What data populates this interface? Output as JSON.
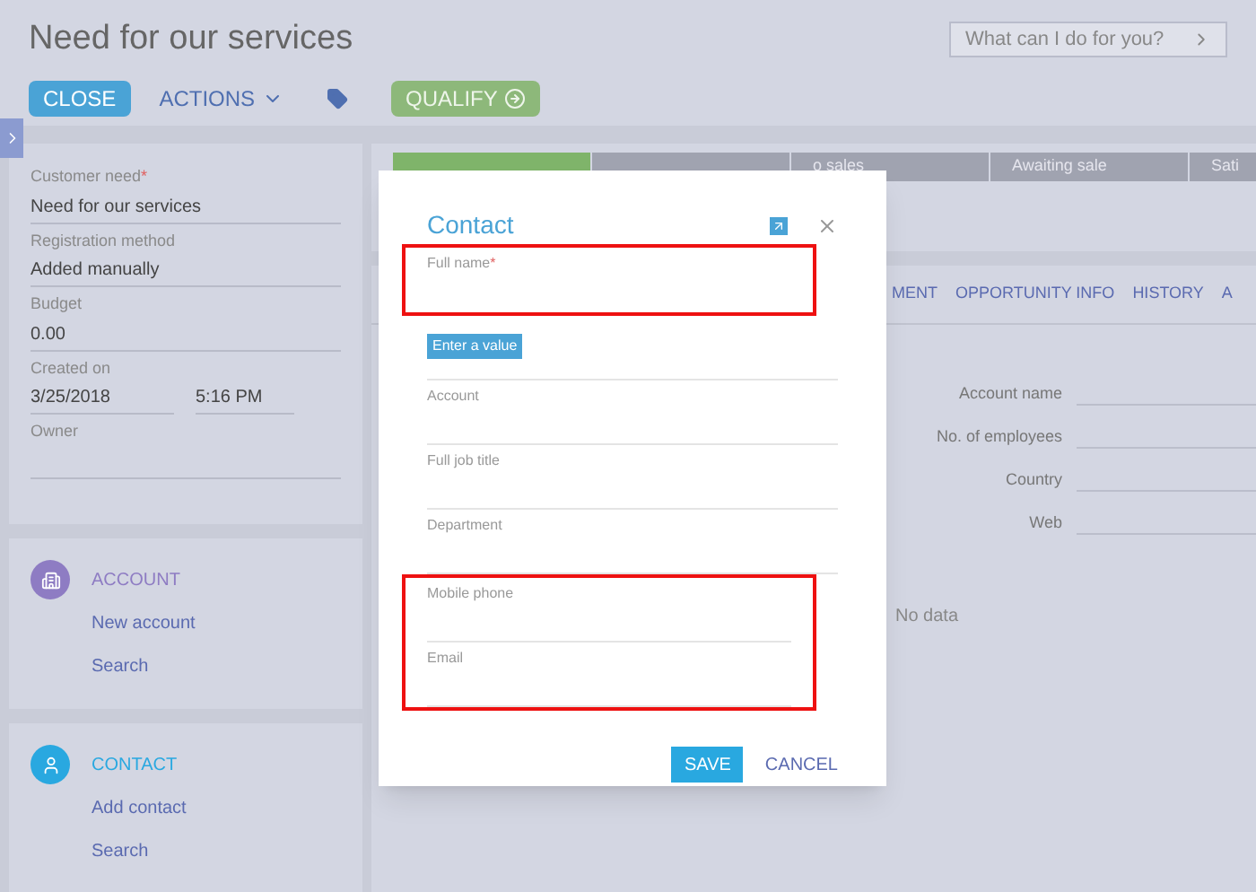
{
  "header": {
    "title": "Need for our services",
    "search_placeholder": "What can I do for you?",
    "buttons": [
      {
        "kind": "primary",
        "label": "CLOSE"
      },
      {
        "kind": "menu",
        "label": "ACTIONS"
      },
      {
        "kind": "tag"
      },
      {
        "kind": "success",
        "label": "QUALIFY"
      }
    ]
  },
  "details": [
    {
      "label": "Customer need",
      "required_mark": "*",
      "value": "Need for our services"
    },
    {
      "label": "Registration method",
      "value": "Added manually"
    },
    {
      "label": "Budget",
      "value": "0.00"
    },
    {
      "label": "Created on",
      "value": "3/25/2018",
      "value_2": "5:16 PM"
    },
    {
      "label": "Owner"
    }
  ],
  "cards": [
    {
      "kind": "account",
      "title": "ACCOUNT",
      "color": "#8e7cc3",
      "links": [
        "New account",
        "Search"
      ]
    },
    {
      "kind": "contact",
      "title": "CONTACT",
      "color": "#29a8e0",
      "links": [
        "Add contact",
        "Search"
      ]
    }
  ],
  "stages": [
    {
      "done": true
    },
    {
      "done": false
    },
    {
      "label": "o sales",
      "done": false
    },
    {
      "label": "Awaiting sale",
      "done": false
    },
    {
      "label": "Sati",
      "done": false
    }
  ],
  "tabs": [
    {
      "label": "MENT",
      "selected": false
    },
    {
      "label": "OPPORTUNITY INFO",
      "selected": false
    },
    {
      "label": "HISTORY",
      "selected": false
    },
    {
      "label": "A",
      "selected": false
    }
  ],
  "account_fields": [
    "Account name",
    "No. of employees",
    "Country",
    "Web"
  ],
  "empty_text": "No data",
  "dialog": {
    "title": "Contact",
    "error_tooltip": "Enter a value",
    "groups": [
      {
        "highlighted": true,
        "fields": [
          {
            "label": "Full name",
            "required_mark": "*"
          }
        ]
      },
      {
        "highlighted": false,
        "fields": [
          {
            "kind": "covered"
          },
          {
            "label": "Account"
          },
          {
            "label": "Full job title"
          },
          {
            "label": "Department"
          }
        ]
      },
      {
        "highlighted": true,
        "fields": [
          {
            "label": "Mobile phone"
          },
          {
            "label": "Email"
          }
        ]
      }
    ],
    "save": "SAVE",
    "cancel": "CANCEL"
  }
}
